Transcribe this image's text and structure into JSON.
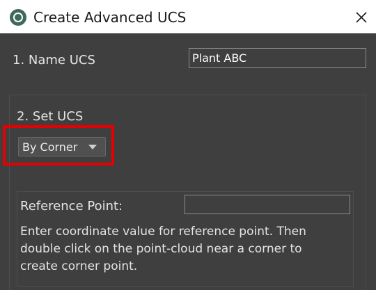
{
  "window": {
    "title": "Create Advanced UCS",
    "close_glyph": "✕",
    "app_icon": "circle-logo-icon"
  },
  "name_section": {
    "label": "1. Name UCS",
    "value": "Plant ABC"
  },
  "set_section": {
    "label": "2. Set UCS",
    "method": {
      "selected": "By Corner",
      "arrow_icon": "triangle-down-icon"
    },
    "reference": {
      "label": "Reference Point:",
      "value": "",
      "help_lines": [
        "Enter coordinate value for reference point. Then",
        "double click on the point-cloud near a corner to",
        "create corner point."
      ]
    }
  },
  "colors": {
    "highlight": "#e60000",
    "background": "#3f3f3f",
    "titlebar": "#ffffff",
    "text": "#e4e4e4"
  }
}
